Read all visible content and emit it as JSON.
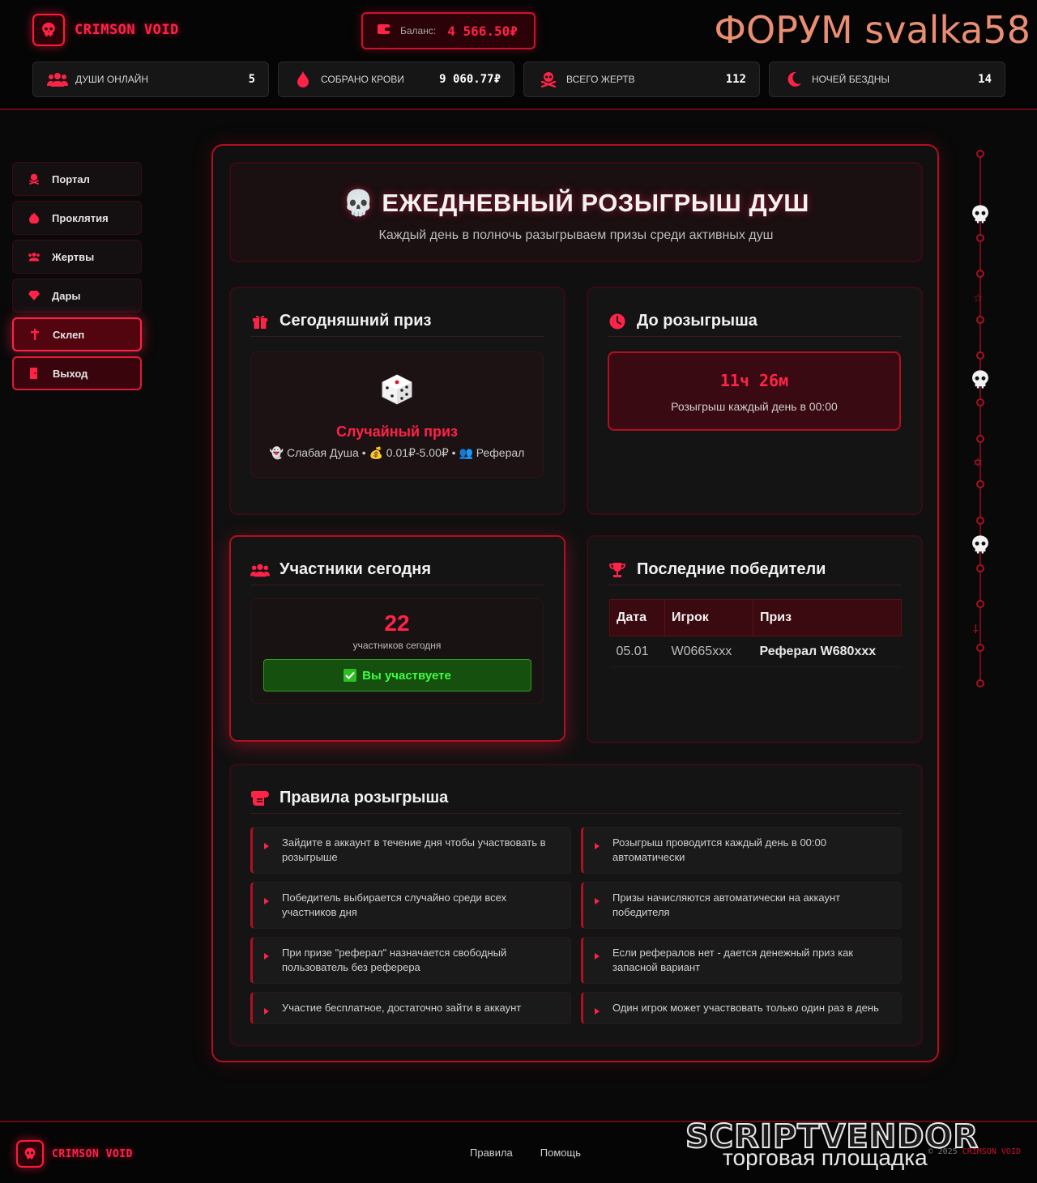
{
  "brand": {
    "name": "CRIMSON VOID"
  },
  "balance": {
    "label": "Баланс:",
    "value": "4 566.50₽"
  },
  "watermark_top": "ФОРУМ svalka58",
  "stats": [
    {
      "label": "ДУШИ ОНЛАЙН",
      "value": "5",
      "icon": "users-icon"
    },
    {
      "label": "СОБРАНО КРОВИ",
      "value": "9 060.77₽",
      "icon": "blood-drop-icon"
    },
    {
      "label": "ВСЕГО ЖЕРТВ",
      "value": "112",
      "icon": "skull-crossbones-icon"
    },
    {
      "label": "НОЧЕЙ БЕЗДНЫ",
      "value": "14",
      "icon": "moon-icon"
    }
  ],
  "sidebar": {
    "items": [
      {
        "label": "Портал"
      },
      {
        "label": "Проклятия"
      },
      {
        "label": "Жертвы"
      },
      {
        "label": "Дары"
      },
      {
        "label": "Склеп",
        "active": true
      },
      {
        "label": "Выход"
      }
    ]
  },
  "hero": {
    "title": "ЕЖЕДНЕВНЫЙ РОЗЫГРЫШ ДУШ",
    "subtitle": "Каждый день в полночь разыгрываем призы среди активных душ"
  },
  "prize": {
    "title": "Сегодняшний приз",
    "name": "Случайный приз",
    "meta": "👻 Слабая Душа • 💰 0.01₽-5.00₽ • 👥 Реферал"
  },
  "timer": {
    "title": "До розыгрыша",
    "value": "11ч 26м",
    "note": "Розыгрыш каждый день в 00:00"
  },
  "participants": {
    "title": "Участники сегодня",
    "count": "22",
    "label": "участников сегодня",
    "status": "Вы участвуете"
  },
  "winners": {
    "title": "Последние победители",
    "columns": [
      "Дата",
      "Игрок",
      "Приз"
    ],
    "rows": [
      {
        "date": "05.01",
        "player": "W0665xxx",
        "prize": "Реферал W680xxx"
      }
    ]
  },
  "rules": {
    "title": "Правила розыгрыша",
    "items": [
      "Зайдите в аккаунт в течение дня чтобы участвовать в розыгрыше",
      "Розыгрыш проводится каждый день в 00:00 автоматически",
      "Победитель выбирается случайно среди всех участников дня",
      "Призы начисляются автоматически на аккаунт победителя",
      "При призе \"реферал\" назначается свободный пользователь без реферера",
      "Если рефералов нет - дается денежный приз как запасной вариант",
      "Участие бесплатное, достаточно зайти в аккаунт",
      "Один игрок может участвовать только один раз в день"
    ]
  },
  "footer": {
    "links": [
      "Правила",
      "Помощь"
    ],
    "copyright_prefix": "© 2025",
    "copyright_brand": "CRIMSON VOID"
  },
  "watermark_bottom": {
    "brand": "SCRIPTVENDOR",
    "subtitle": "торговая площадка"
  },
  "colors": {
    "accent": "#ff2347",
    "border": "#b0101f",
    "background": "#090909",
    "success": "#3cff3c"
  }
}
